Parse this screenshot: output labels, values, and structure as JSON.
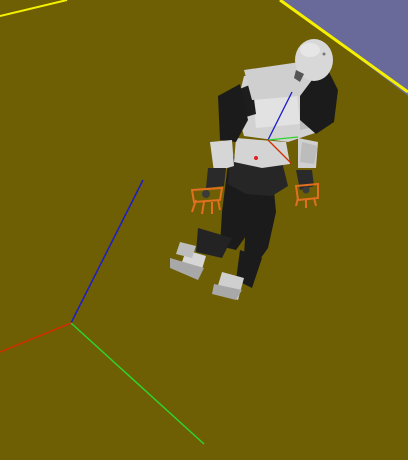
{
  "scene": {
    "ground_color": "#6e5e04",
    "sky_color": "#6a6a9a",
    "edge_color": "#f5f000",
    "axes": {
      "x_color": "#d03000",
      "y_color": "#2ed42e",
      "z_color": "#1c1ccc"
    },
    "robot": {
      "body_white": "#dcdcdc",
      "body_black": "#1b1b1b",
      "gripper_color": "#e07020"
    }
  }
}
